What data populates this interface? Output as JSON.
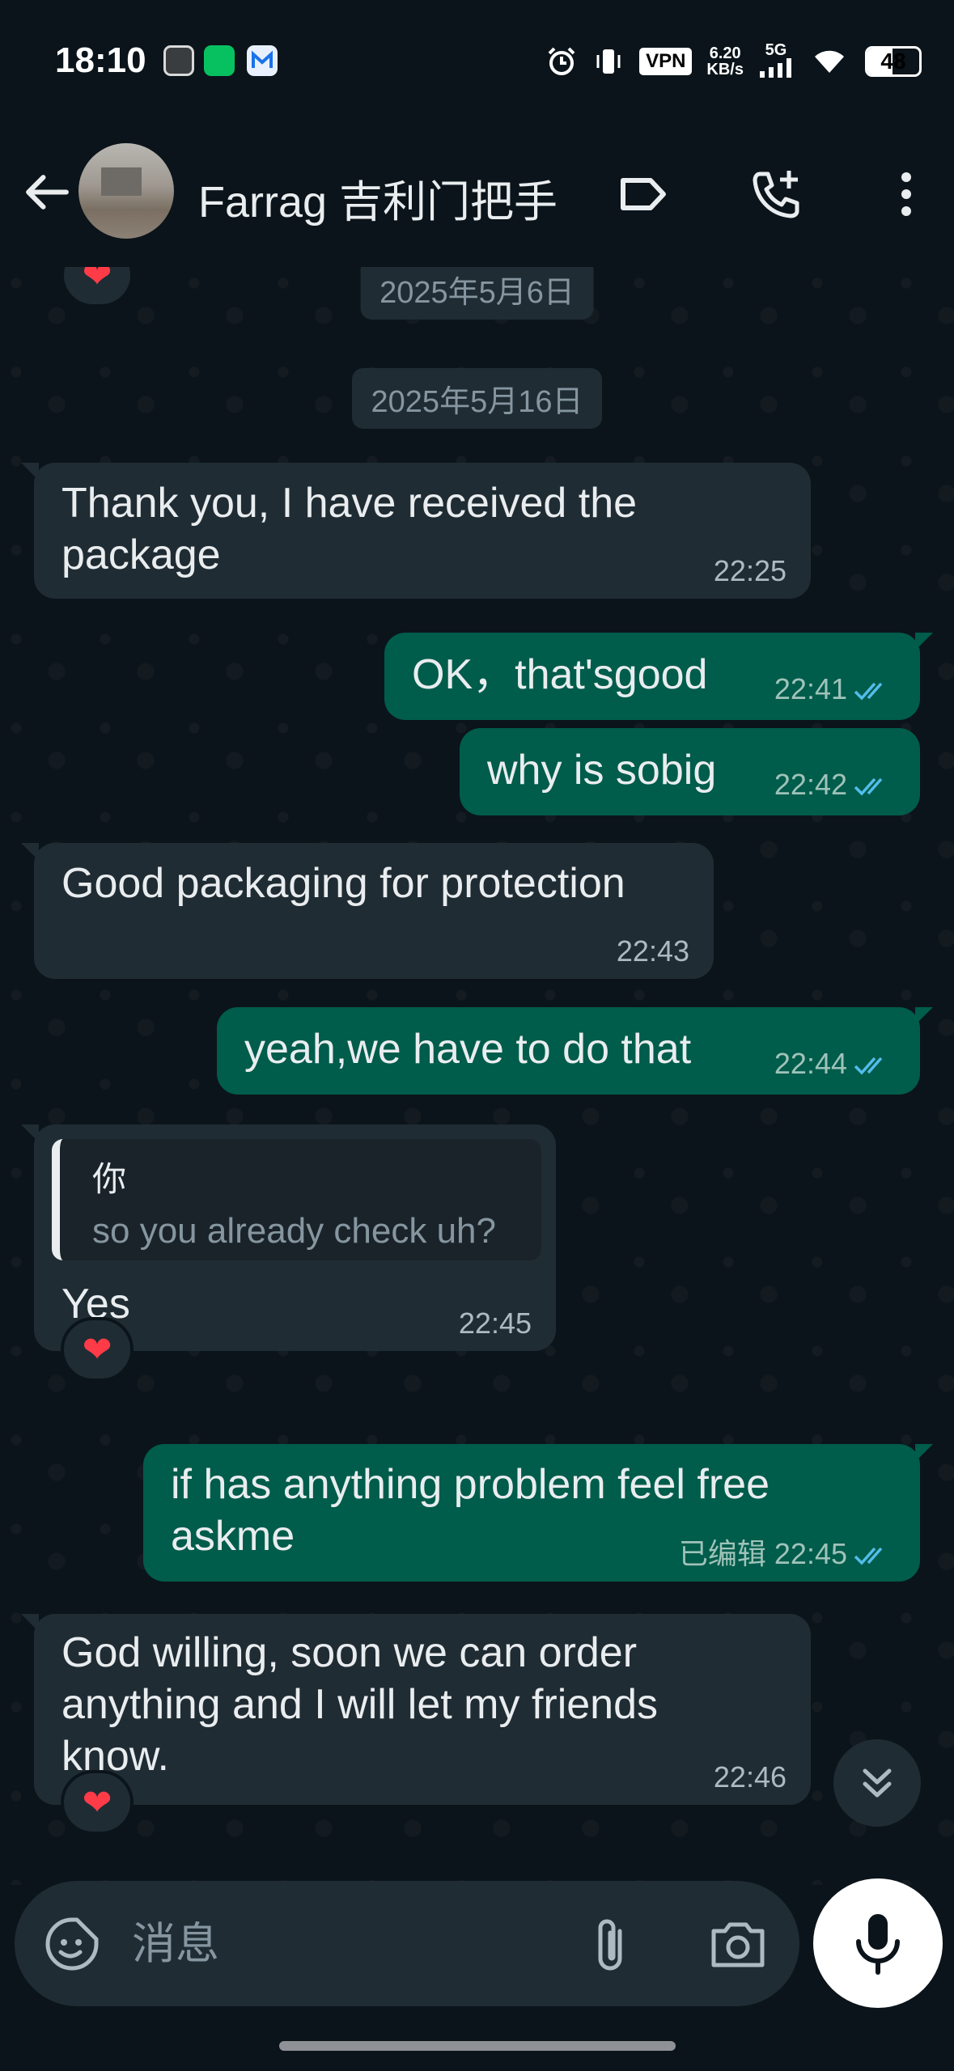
{
  "status_bar": {
    "time": "18:10",
    "vpn": "VPN",
    "speed_value": "6.20",
    "speed_unit": "KB/s",
    "network": "5G",
    "battery": "48",
    "battery_level": 0.48,
    "app_icons": [
      "camera-app-icon",
      "wechat-icon",
      "mail-icon"
    ],
    "right_icons": [
      "alarm-icon",
      "vibrate-icon",
      "signal-icon",
      "wifi-icon"
    ]
  },
  "header": {
    "contact_name": "Farrag 吉利门把手",
    "icons": [
      "back-arrow-icon",
      "label-icon",
      "add-call-icon",
      "more-vert-icon"
    ]
  },
  "chat": {
    "dates": [
      "2025年5月6日",
      "2025年5月16日"
    ],
    "reaction": "❤",
    "messages": [
      {
        "dir": "in",
        "text": "Thank you, I have received the package",
        "line1": "Thank you, I have received the",
        "line2": "package",
        "time": "22:25"
      },
      {
        "dir": "out",
        "text": "OK，that'sgood",
        "time": "22:41",
        "status": "read"
      },
      {
        "dir": "out",
        "text": "why is sobig",
        "time": "22:42",
        "status": "read"
      },
      {
        "dir": "in",
        "text": "Good packaging for protection",
        "time": "22:43"
      },
      {
        "dir": "out",
        "text": "yeah,we have to do that",
        "time": "22:44",
        "status": "read"
      },
      {
        "dir": "in",
        "quote_sender": "你",
        "quote_text": "so you already check uh?",
        "text": "Yes",
        "time": "22:45",
        "reaction": "❤"
      },
      {
        "dir": "out",
        "text": "if has anything  problem feel free askme",
        "line1": "if has anything  problem feel free",
        "line2": "askme",
        "edited": "已编辑",
        "time": "22:45",
        "status": "read"
      },
      {
        "dir": "in",
        "text": "God willing, soon we can order anything and I will let my friends know.",
        "line1": "God willing, soon we can order",
        "line2": "anything and I will let my friends",
        "line3": "know.",
        "time": "22:46",
        "reaction": "❤"
      }
    ]
  },
  "input": {
    "placeholder": "消息",
    "icons": [
      "sticker-icon",
      "attach-icon",
      "camera-icon",
      "mic-icon"
    ]
  },
  "colors": {
    "background": "#0b141a",
    "incoming_bubble": "#202c33",
    "outgoing_bubble": "#005c4b",
    "read_ticks": "#53bdeb",
    "reaction_heart": "#ff3b48"
  }
}
